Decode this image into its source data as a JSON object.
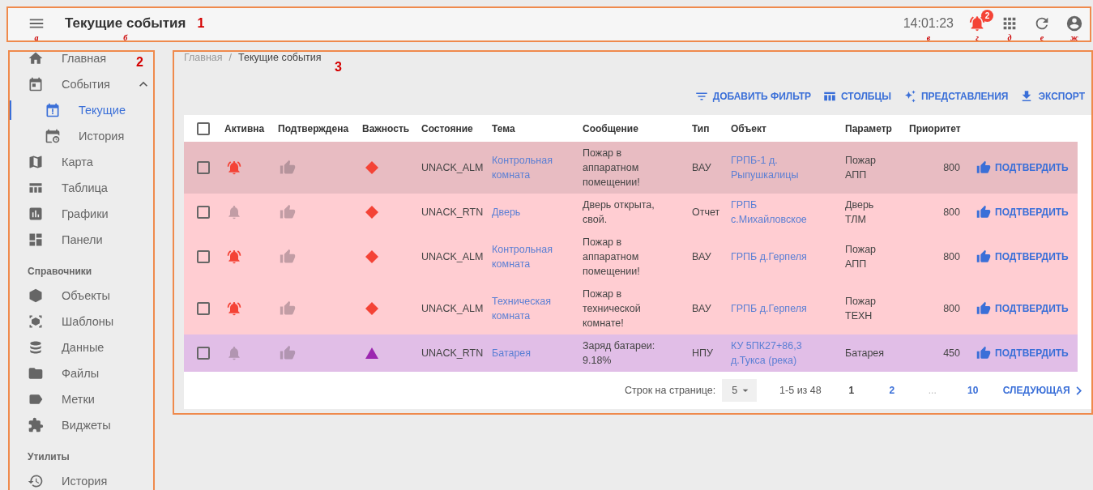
{
  "header": {
    "menu_callout": "а",
    "title": "Текущие события",
    "title_callout": "б",
    "region_label": "1",
    "clock": "14:01:23",
    "clock_callout": "в",
    "tools": [
      {
        "kind": "notifications",
        "badge": "2",
        "callout": "г"
      },
      {
        "kind": "apps",
        "callout": "д"
      },
      {
        "kind": "refresh",
        "callout": "е"
      },
      {
        "kind": "account",
        "callout": "ж"
      }
    ]
  },
  "sidebar": {
    "region_label": "2",
    "sections": [
      {
        "items": [
          {
            "kind": "home",
            "label": "Главная",
            "selected": false
          },
          {
            "kind": "events",
            "label": "События",
            "selected": false,
            "expanded": true,
            "children": [
              {
                "kind": "current",
                "label": "Текущие",
                "selected": true
              },
              {
                "kind": "event-history",
                "label": "История",
                "selected": false
              }
            ]
          },
          {
            "kind": "map",
            "label": "Карта",
            "selected": false
          },
          {
            "kind": "table",
            "label": "Таблица",
            "selected": false
          },
          {
            "kind": "charts",
            "label": "Графики",
            "selected": false
          },
          {
            "kind": "panels",
            "label": "Панели",
            "selected": false
          }
        ]
      },
      {
        "title": "Справочники",
        "items": [
          {
            "kind": "objects",
            "label": "Объекты",
            "selected": false
          },
          {
            "kind": "templates",
            "label": "Шаблоны",
            "selected": false
          },
          {
            "kind": "data",
            "label": "Данные",
            "selected": false
          },
          {
            "kind": "files",
            "label": "Файлы",
            "selected": false
          },
          {
            "kind": "labels",
            "label": "Метки",
            "selected": false
          },
          {
            "kind": "widgets",
            "label": "Виджеты",
            "selected": false
          }
        ]
      },
      {
        "title": "Утилиты",
        "items": [
          {
            "kind": "history",
            "label": "История",
            "selected": false
          }
        ]
      }
    ]
  },
  "content": {
    "region_label": "3",
    "breadcrumbs": [
      {
        "label": "Главная",
        "current": false
      },
      {
        "label": "Текущие события",
        "current": true
      }
    ],
    "breadcrumb_separator": "/",
    "toolbar": [
      {
        "kind": "filter",
        "label": "ДОБАВИТЬ ФИЛЬТР"
      },
      {
        "kind": "columns",
        "label": "СТОЛБЦЫ"
      },
      {
        "kind": "views",
        "label": "ПРЕДСТАВЛЕНИЯ"
      },
      {
        "kind": "export",
        "label": "ЭКСПОРТ"
      }
    ],
    "table": {
      "select_all_checked": false,
      "columns": [
        "Активна",
        "Подтверждена",
        "Важность",
        "Состояние",
        "Тема",
        "Сообщение",
        "Тип",
        "Объект",
        "Параметр",
        "Приоритет"
      ],
      "rows": [
        {
          "checked": false,
          "color": "#e8bcc2",
          "active": true,
          "acknowledged": false,
          "severity": {
            "kind": "diamond",
            "color": "#f44336"
          },
          "state": "UNACK_ALM",
          "topic": "Контрольная комната",
          "message": "Пожар в аппаратном помещении!",
          "type": "ВАУ",
          "object": "ГРПБ-1 д. Рыпушкалицы",
          "parameter": "Пожар АПП",
          "priority": "800",
          "action": "ПОДТВЕРДИТЬ"
        },
        {
          "checked": false,
          "color": "#ffcdd2",
          "active": false,
          "acknowledged": false,
          "severity": {
            "kind": "diamond",
            "color": "#f44336"
          },
          "state": "UNACK_RTN",
          "topic": "Дверь",
          "message": "Дверь открыта, свой.",
          "type": "Отчет",
          "object": "ГРПБ с.Михайловское",
          "parameter": "Дверь ТЛМ",
          "priority": "800",
          "action": "ПОДТВЕРДИТЬ"
        },
        {
          "checked": false,
          "color": "#ffcdd2",
          "active": true,
          "acknowledged": false,
          "severity": {
            "kind": "diamond",
            "color": "#f44336"
          },
          "state": "UNACK_ALM",
          "topic": "Контрольная комната",
          "message": "Пожар в аппаратном помещении!",
          "type": "ВАУ",
          "object": "ГРПБ д.Герпеля",
          "parameter": "Пожар АПП",
          "priority": "800",
          "action": "ПОДТВЕРДИТЬ"
        },
        {
          "checked": false,
          "color": "#ffcdd2",
          "active": true,
          "acknowledged": false,
          "severity": {
            "kind": "diamond",
            "color": "#f44336"
          },
          "state": "UNACK_ALM",
          "topic": "Техническая комната",
          "message": "Пожар в технической комнате!",
          "type": "ВАУ",
          "object": "ГРПБ д.Герпеля",
          "parameter": "Пожар ТЕХН",
          "priority": "800",
          "action": "ПОДТВЕРДИТЬ"
        },
        {
          "checked": false,
          "color": "#e1bee7",
          "active": false,
          "acknowledged": false,
          "severity": {
            "kind": "triangle",
            "color": "#9c27b0"
          },
          "state": "UNACK_RTN",
          "topic": "Батарея",
          "message": "Заряд батареи: 9.18%",
          "type": "НПУ",
          "object": "КУ 5ПК27+86,3 д.Тукса (река)",
          "parameter": "Батарея",
          "priority": "450",
          "action": "ПОДТВЕРДИТЬ"
        }
      ]
    },
    "pagination": {
      "rows_per_page_label": "Строк на странице:",
      "rows_per_page": "5",
      "range": "1-5 из 48",
      "pages": [
        {
          "kind": "page",
          "label": "1",
          "selected": true
        },
        {
          "kind": "page",
          "label": "2",
          "selected": false
        },
        {
          "kind": "ellipsis",
          "label": "..."
        },
        {
          "kind": "page",
          "label": "10",
          "selected": false
        }
      ],
      "next": "СЛЕДУЮЩАЯ"
    }
  }
}
